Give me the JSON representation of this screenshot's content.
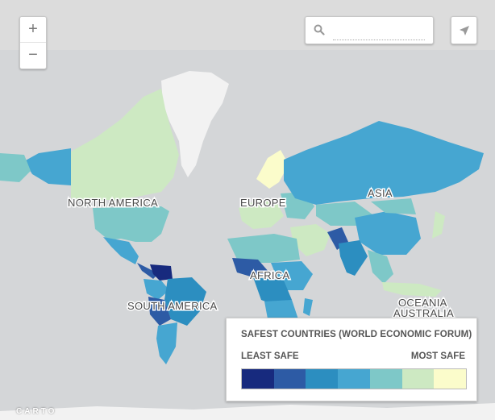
{
  "controls": {
    "zoom_in": "+",
    "zoom_out": "−",
    "search_placeholder": ""
  },
  "labels": {
    "north_america": "NORTH AMERICA",
    "south_america": "SOUTH AMERICA",
    "europe": "EUROPE",
    "africa": "AFRICA",
    "asia": "ASIA",
    "oceania": "OCEANIA",
    "australia": "AUSTRALIA"
  },
  "legend": {
    "title": "SAFEST COUNTRIES (WORLD ECONOMIC FORUM)",
    "low_label": "LEAST SAFE",
    "high_label": "MOST SAFE",
    "colors": [
      "#172a7e",
      "#2d5ba5",
      "#2c8ec0",
      "#46a6d1",
      "#7ec8c8",
      "#cde9c2",
      "#fbfccb"
    ]
  },
  "attribution": "CARTO",
  "icons": {
    "search": "search-icon",
    "locate": "locate-arrow-icon"
  }
}
